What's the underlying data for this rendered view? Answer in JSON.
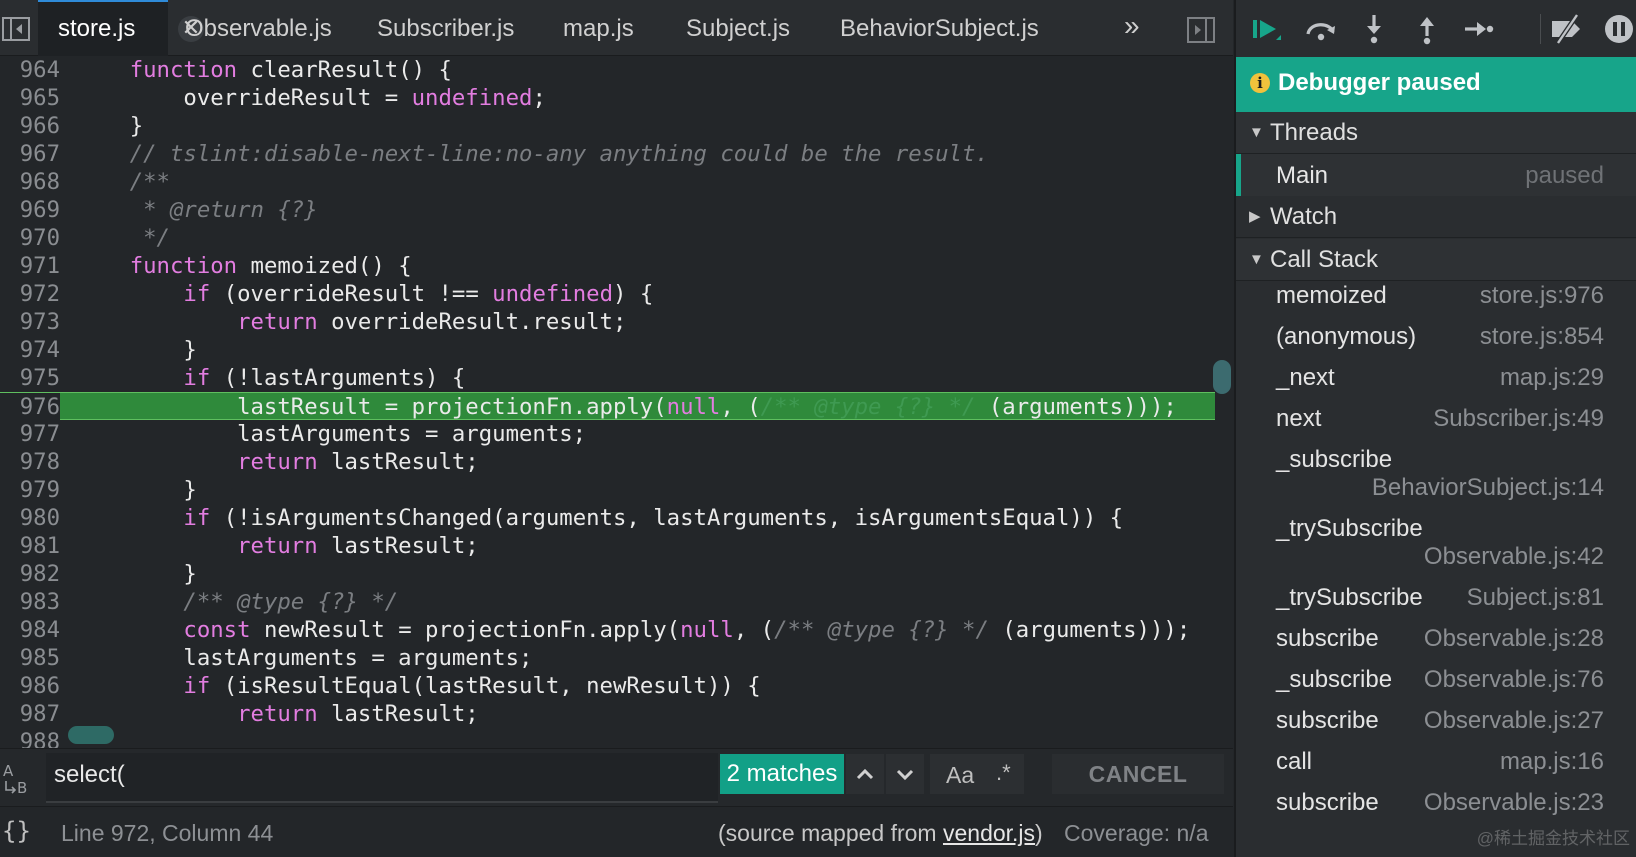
{
  "tabs": [
    {
      "label": "store.js",
      "active": true
    },
    {
      "label": "Observable.js"
    },
    {
      "label": "Subscriber.js"
    },
    {
      "label": "map.js"
    },
    {
      "label": "Subject.js"
    },
    {
      "label": "BehaviorSubject.js"
    }
  ],
  "tab_close_glyph": "✕",
  "tabs_overflow_glyph": "»",
  "code_lines": [
    {
      "n": "964"
    },
    {
      "n": "965"
    },
    {
      "n": "966"
    },
    {
      "n": "967"
    },
    {
      "n": "968"
    },
    {
      "n": "969"
    },
    {
      "n": "970"
    },
    {
      "n": "971"
    },
    {
      "n": "972"
    },
    {
      "n": "973"
    },
    {
      "n": "974"
    },
    {
      "n": "975"
    },
    {
      "n": "976",
      "current": true
    },
    {
      "n": "977"
    },
    {
      "n": "978"
    },
    {
      "n": "979"
    },
    {
      "n": "980"
    },
    {
      "n": "981"
    },
    {
      "n": "982"
    },
    {
      "n": "983"
    },
    {
      "n": "984"
    },
    {
      "n": "985"
    },
    {
      "n": "986"
    },
    {
      "n": "987"
    },
    {
      "n": "988"
    }
  ],
  "code_tokens": [
    [
      [
        "    "
      ],
      [
        "function",
        "kw"
      ],
      [
        " clearResult() {"
      ]
    ],
    [
      [
        "        overrideResult = "
      ],
      [
        "undefined",
        "kw"
      ],
      [
        ";"
      ]
    ],
    [
      [
        "    }"
      ]
    ],
    [
      [
        "    "
      ],
      [
        "// tslint:disable-next-line:no-any anything could be the result.",
        "cm"
      ]
    ],
    [
      [
        "    "
      ],
      [
        "/**",
        "cm"
      ]
    ],
    [
      [
        "     "
      ],
      [
        "* @return {?}",
        "cm"
      ]
    ],
    [
      [
        "     "
      ],
      [
        "*/",
        "cm"
      ]
    ],
    [
      [
        "    "
      ],
      [
        "function",
        "kw"
      ],
      [
        " memoized() {"
      ]
    ],
    [
      [
        "        "
      ],
      [
        "if",
        "kw"
      ],
      [
        " (overrideResult !== "
      ],
      [
        "undefined",
        "kw"
      ],
      [
        ") {"
      ]
    ],
    [
      [
        "            "
      ],
      [
        "return",
        "kw"
      ],
      [
        " overrideResult.result;"
      ]
    ],
    [
      [
        "        }"
      ]
    ],
    [
      [
        "        "
      ],
      [
        "if",
        "kw"
      ],
      [
        " (!lastArguments) {"
      ]
    ],
    [
      [
        "            lastResult = projectionFn.apply("
      ],
      [
        "null",
        "kw"
      ],
      [
        ", ("
      ],
      [
        "/** @type {?} */",
        "cmh"
      ],
      [
        " (arguments)));"
      ]
    ],
    [
      [
        "            lastArguments = arguments;"
      ]
    ],
    [
      [
        "            "
      ],
      [
        "return",
        "kw"
      ],
      [
        " lastResult;"
      ]
    ],
    [
      [
        "        }"
      ]
    ],
    [
      [
        "        "
      ],
      [
        "if",
        "kw"
      ],
      [
        " (!isArgumentsChanged(arguments, lastArguments, isArgumentsEqual)) {"
      ]
    ],
    [
      [
        "            "
      ],
      [
        "return",
        "kw"
      ],
      [
        " lastResult;"
      ]
    ],
    [
      [
        "        }"
      ]
    ],
    [
      [
        "        "
      ],
      [
        "/** @type {?} */",
        "cm"
      ]
    ],
    [
      [
        "        "
      ],
      [
        "const",
        "kw"
      ],
      [
        " newResult = projectionFn.apply("
      ],
      [
        "null",
        "kw"
      ],
      [
        ", ("
      ],
      [
        "/** @type {?} */",
        "cm"
      ],
      [
        " (arguments)));"
      ]
    ],
    [
      [
        "        lastArguments = arguments;"
      ]
    ],
    [
      [
        "        "
      ],
      [
        "if",
        "kw"
      ],
      [
        " (isResultEqual(lastResult, newResult)) {"
      ]
    ],
    [
      [
        "            "
      ],
      [
        "return",
        "kw"
      ],
      [
        " lastResult;"
      ]
    ],
    [
      [
        ""
      ]
    ]
  ],
  "search": {
    "value": "select(",
    "matches_label": "2 matches",
    "case_label": "Aa",
    "regex_label": ".*",
    "cancel_label": "CANCEL"
  },
  "status": {
    "braces": "{}",
    "position": "Line 972, Column 44",
    "mapped_prefix": "(source mapped from ",
    "mapped_link": "vendor.js",
    "mapped_suffix": ")",
    "coverage": "Coverage: n/a"
  },
  "debugger": {
    "banner": "Debugger paused",
    "banner_icon": "i",
    "threads_label": "Threads",
    "thread_name": "Main",
    "thread_state": "paused",
    "watch_label": "Watch",
    "callstack_label": "Call Stack",
    "frames": [
      {
        "fn": "memoized",
        "loc": "store.js:976"
      },
      {
        "fn": "(anonymous)",
        "loc": "store.js:854"
      },
      {
        "fn": "_next",
        "loc": "map.js:29"
      },
      {
        "fn": "next",
        "loc": "Subscriber.js:49"
      },
      {
        "fn": "_subscribe",
        "loc": "BehaviorSubject.js:14",
        "wrap": true
      },
      {
        "fn": "_trySubscribe",
        "loc": "Observable.js:42",
        "wrap": true
      },
      {
        "fn": "_trySubscribe",
        "loc": "Subject.js:81"
      },
      {
        "fn": "subscribe",
        "loc": "Observable.js:28"
      },
      {
        "fn": "_subscribe",
        "loc": "Observable.js:76"
      },
      {
        "fn": "subscribe",
        "loc": "Observable.js:27"
      },
      {
        "fn": "call",
        "loc": "map.js:16"
      },
      {
        "fn": "subscribe",
        "loc": "Observable.js:23"
      }
    ]
  },
  "watermark": "@稀土掘金技术社区",
  "colors": {
    "accent": "#17a58a",
    "current_line": "#2f8a3b",
    "keyword": "#e27de0",
    "comment": "#7b7e82"
  }
}
